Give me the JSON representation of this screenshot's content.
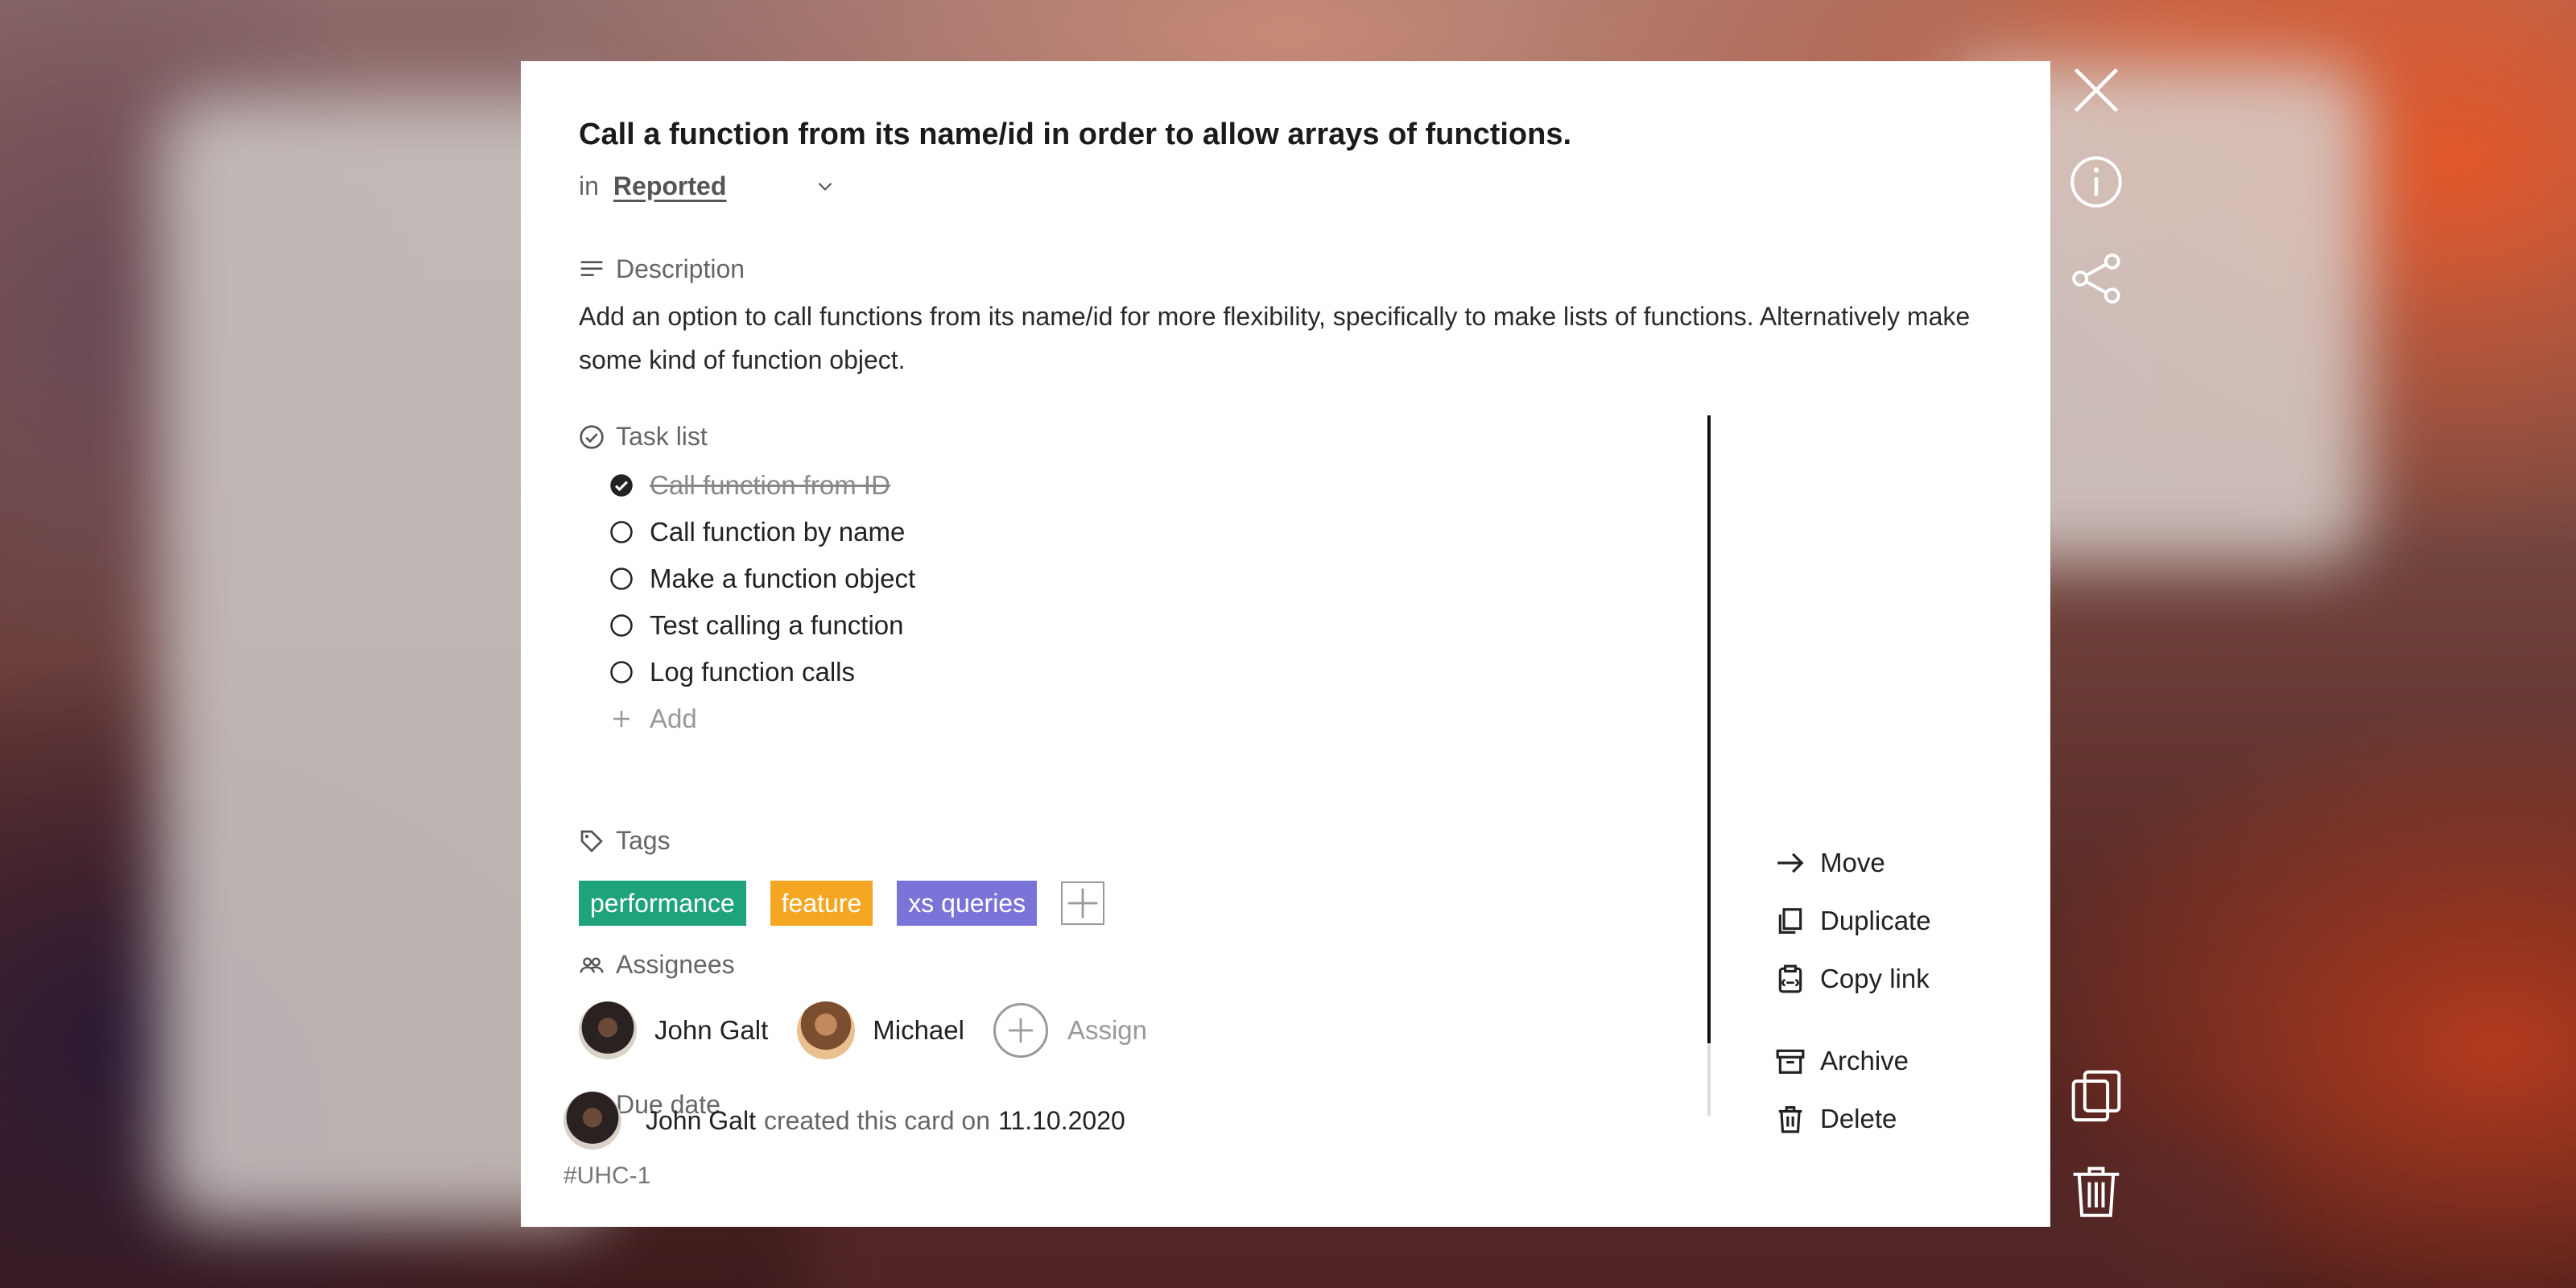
{
  "card": {
    "title": "Call a function from its name/id in order to allow arrays of functions.",
    "in_label": "in",
    "list_name": "Reported",
    "description_heading": "Description",
    "description": "Add an option to call functions from its name/id for more flexibility, specifically to make lists of functions. Alternatively make some kind of function object.",
    "tasklist_heading": "Task list",
    "tasks": [
      {
        "label": "Call function from ID",
        "done": true
      },
      {
        "label": "Call function by name",
        "done": false
      },
      {
        "label": "Make a function object",
        "done": false
      },
      {
        "label": "Test calling a function",
        "done": false
      },
      {
        "label": "Log function calls",
        "done": false
      }
    ],
    "add_task_label": "Add",
    "tags_heading": "Tags",
    "tags": [
      {
        "label": "performance",
        "color": "#1fa37a"
      },
      {
        "label": "feature",
        "color": "#f5a623"
      },
      {
        "label": "xs queries",
        "color": "#7b74d8"
      }
    ],
    "assignees_heading": "Assignees",
    "assignees": [
      {
        "name": "John Galt"
      },
      {
        "name": "Michael"
      }
    ],
    "assign_label": "Assign",
    "due_date_heading": "Due date"
  },
  "actions": {
    "move": "Move",
    "duplicate": "Duplicate",
    "copy_link": "Copy link",
    "archive": "Archive",
    "delete": "Delete"
  },
  "footer": {
    "creator": "John Galt",
    "created_text": "created this card on",
    "created_date": "11.10.2020",
    "card_id": "#UHC-1"
  },
  "side_icons": [
    "close-icon",
    "info-icon",
    "share-icon",
    "duplicate-icon",
    "trash-icon"
  ]
}
